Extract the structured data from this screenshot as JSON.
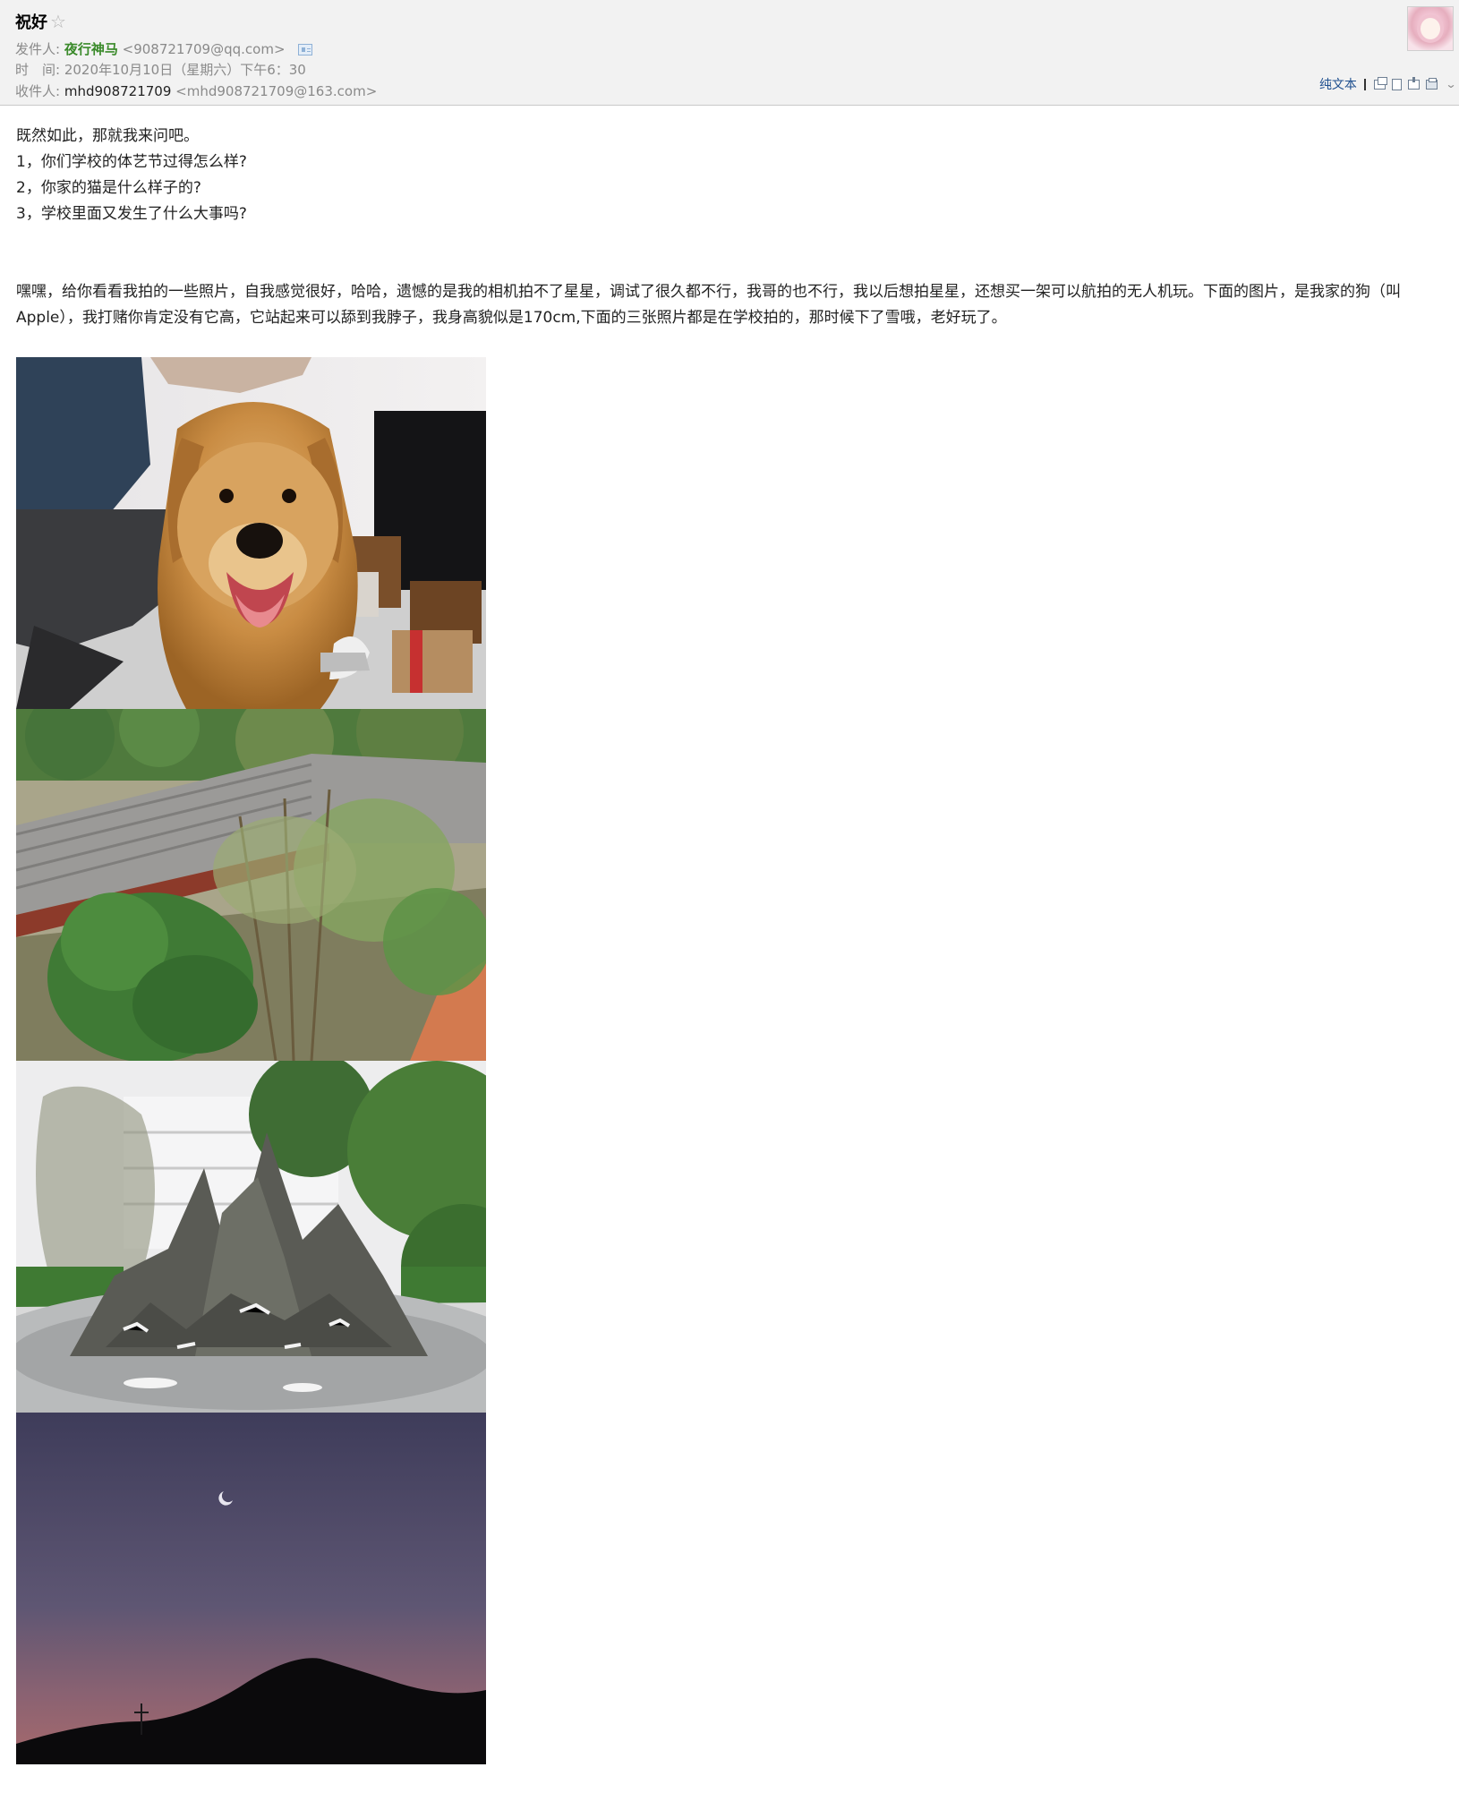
{
  "header": {
    "subject": "祝好",
    "from_label": "发件人:",
    "sender_name": "夜行神马",
    "sender_email": "<908721709@qq.com>",
    "time_label": "时　间:",
    "time_value": "2020年10月10日（星期六）下午6：30",
    "to_label": "收件人:",
    "recipient_name": "mhd908721709",
    "recipient_email": "<mhd908721709@163.com>"
  },
  "toolbar": {
    "plain_text": "纯文本",
    "icons": [
      "new-window-icon",
      "page-icon",
      "archive-icon",
      "print-icon",
      "expand-icon"
    ]
  },
  "body": {
    "intro": "既然如此，那就我来问吧。",
    "questions": [
      "1，你们学校的体艺节过得怎么样?",
      "2，你家的猫是什么样子的?",
      "3，学校里面又发生了什么大事吗?"
    ],
    "paragraph": "嘿嘿，给你看看我拍的一些照片，自我感觉很好，哈哈，遗憾的是我的相机拍不了星星，调试了很久都不行，我哥的也不行，我以后想拍星星，还想买一架可以航拍的无人机玩。下面的图片，是我家的狗（叫Apple），我打赌你肯定没有它高，它站起来可以舔到我脖子，我身高貌似是170cm,下面的三张照片都是在学校拍的，那时候下了雪哦，老好玩了。"
  },
  "photos": [
    {
      "subject": "golden-retriever-dog"
    },
    {
      "subject": "school-courtyard-trees"
    },
    {
      "subject": "rockery-garden-snow"
    },
    {
      "subject": "crescent-moon-dusk-sky"
    }
  ]
}
